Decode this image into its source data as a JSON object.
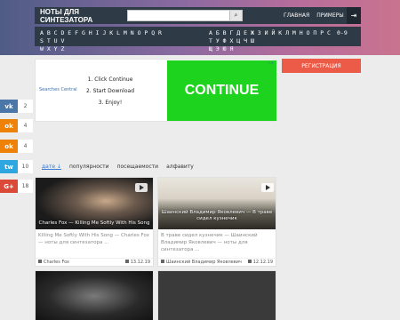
{
  "header": {
    "logo": "НОТЫ ДЛЯ СИНТЕЗАТОРА",
    "search_placeholder": "",
    "nav": [
      "ГЛАВНАЯ",
      "ПРИМЕРЫ"
    ]
  },
  "alphabet": {
    "latin_line1": "A B C D E F G H I J K L M N O P Q R S T U V",
    "latin_line2": "W X Y Z",
    "cyr_line1": "А Б В Г Д Е Ж З И Й К Л М Н О П Р С Т У Ф Х Ц Ч Ш",
    "cyr_line2": "Щ Э Ю Я",
    "digits": "0-9"
  },
  "ad": {
    "brand": "Searches Central",
    "steps": [
      "1. Click Continue",
      "2. Start Download",
      "3. Enjoy!"
    ],
    "cta": "CONTINUE",
    "tag": "▷✕"
  },
  "register_label": "РЕГИСТРАЦИЯ",
  "share": [
    {
      "icon": "vk-icon",
      "glyph": "vk",
      "color": "#4a76a8",
      "count": "2"
    },
    {
      "icon": "odnoklassniki-icon",
      "glyph": "ok",
      "color": "#ee8208",
      "count": "4"
    },
    {
      "icon": "odnoklassniki-icon",
      "glyph": "ok",
      "color": "#ee8208",
      "count": "4"
    },
    {
      "icon": "twitter-icon",
      "glyph": "tw",
      "color": "#2ea7e0",
      "count": "10"
    },
    {
      "icon": "google-plus-icon",
      "glyph": "G+",
      "color": "#db4a39",
      "count": "18"
    }
  ],
  "sort": {
    "items": [
      "дате ↓",
      "популярности",
      "посещаемости",
      "алфавиту"
    ]
  },
  "cards": [
    {
      "thumb_title": "Charles Fox — Killing Me Softly With His Song",
      "description": "Killing Me Softly With His Song — Charles Fox — ноты для синтезатора ...",
      "author": "Charles Fox",
      "date": "13.12.19"
    },
    {
      "thumb_title": "Шаинский Владимир Яковлевич — В траве сидел кузнечик",
      "description": "В траве сидел кузнечик — Шаинский Владимир Яковлевич — ноты для синтезатора ...",
      "author": "Шаинский Владимир Яковлевич",
      "date": "12.12.19"
    }
  ]
}
